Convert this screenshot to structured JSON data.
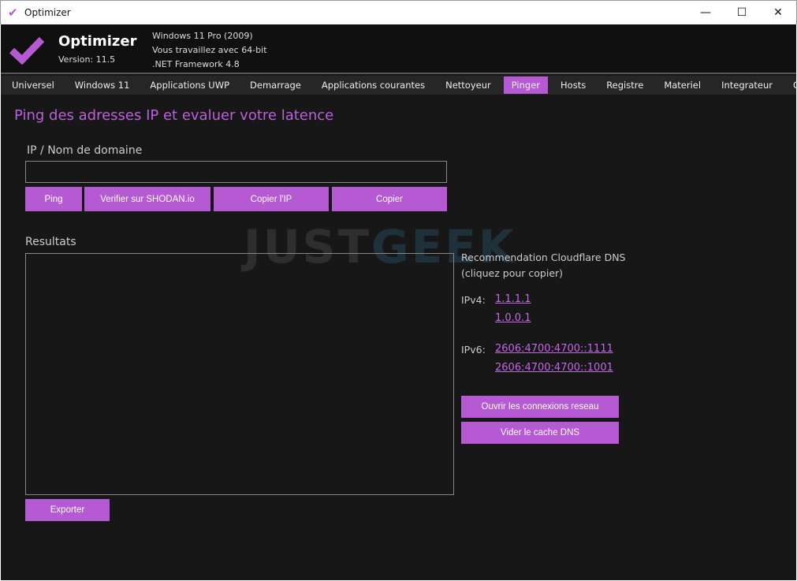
{
  "window": {
    "title": "Optimizer",
    "minimize": "—",
    "maximize": "☐",
    "close": "✕"
  },
  "header": {
    "app_name": "Optimizer",
    "version": "Version: 11.5",
    "os": "Windows 11 Pro (2009)",
    "arch": "Vous travaillez avec 64-bit",
    "framework": ".NET Framework 4.8"
  },
  "tabs": [
    {
      "label": "Universel"
    },
    {
      "label": "Windows 11"
    },
    {
      "label": "Applications UWP"
    },
    {
      "label": "Demarrage"
    },
    {
      "label": "Applications courantes"
    },
    {
      "label": "Nettoyeur"
    },
    {
      "label": "Pinger",
      "active": true
    },
    {
      "label": "Hosts"
    },
    {
      "label": "Registre"
    },
    {
      "label": "Materiel"
    },
    {
      "label": "Integrateur"
    },
    {
      "label": "Options"
    }
  ],
  "main": {
    "title": "Ping des adresses IP et evaluer votre latence",
    "ip_label": "IP / Nom de domaine",
    "ip_value": "",
    "ping": "Ping",
    "shodan": "Verifier sur SHODAN.io",
    "copy_ip": "Copier l'IP",
    "copy": "Copier",
    "results_label": "Resultats",
    "export": "Exporter"
  },
  "dns": {
    "title": "Recommendation Cloudflare DNS",
    "subtitle": "(cliquez pour copier)",
    "ipv4_label": "IPv4:",
    "ipv4": [
      "1.1.1.1",
      "1.0.0.1"
    ],
    "ipv6_label": "IPv6:",
    "ipv6": [
      "2606:4700:4700::1111",
      "2606:4700:4700::1001"
    ],
    "open_connections": "Ouvrir les connexions reseau",
    "flush_dns": "Vider le cache DNS"
  },
  "watermark": {
    "part1": "JUST",
    "part2": "GEEK"
  },
  "colors": {
    "accent": "#b65ad4",
    "background": "#171717"
  }
}
